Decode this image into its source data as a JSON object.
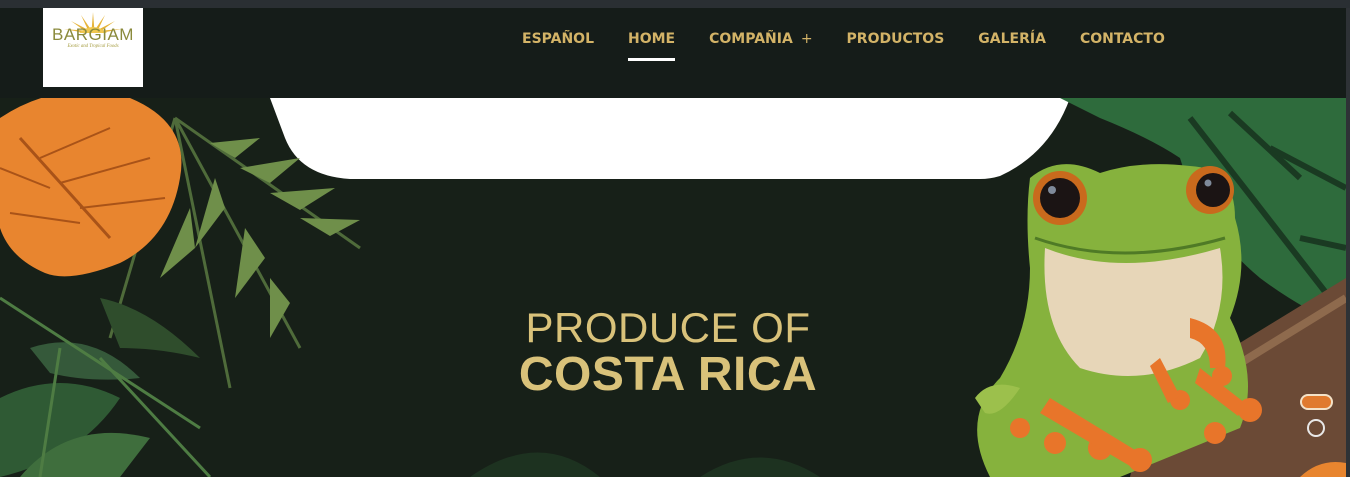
{
  "brand": {
    "name": "BARGIAM",
    "tagline": "Exotic and Tropical Foods"
  },
  "nav": {
    "items": [
      {
        "label": "ESPAÑOL"
      },
      {
        "label": "HOME",
        "active": true
      },
      {
        "label": "COMPAÑIA",
        "suffix": "+"
      },
      {
        "label": "PRODUCTOS"
      },
      {
        "label": "GALERÍA"
      },
      {
        "label": "CONTACTO"
      }
    ]
  },
  "hero": {
    "line1": "PRODUCE OF",
    "line2": "COSTA RICA",
    "slides_total": 2,
    "active_slide": 1
  },
  "colors": {
    "header_bg": "#151c19",
    "nav_text": "#d3b367",
    "headline_text": "#d9c27a",
    "active_dot": "#e07a2e"
  },
  "icons": [
    "sun-logo-icon",
    "monstera-leaf-icon",
    "palm-leaf-icon",
    "tree-frog-illustration"
  ]
}
